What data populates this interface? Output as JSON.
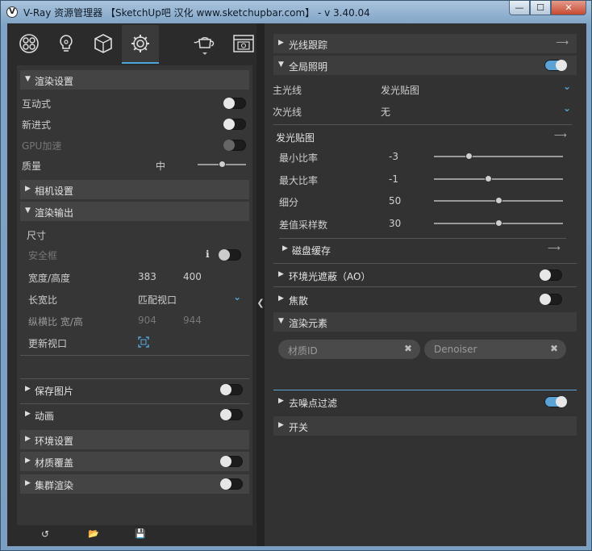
{
  "window": {
    "title": "V-Ray 资源管理器 【SketchUp吧 汉化 www.sketchupbar.com】 - v 3.40.04",
    "min_label": "—",
    "max_label": "☐",
    "close_label": "✕"
  },
  "toolbar": {
    "tabs": [
      "materials-icon",
      "lights-icon",
      "geometry-icon",
      "settings-icon"
    ],
    "active": "settings-icon",
    "right_icons": [
      "teapot-render-icon",
      "frame-buffer-icon"
    ]
  },
  "left": {
    "render_settings": {
      "title": "渲染设置",
      "interactive_label": "互动式",
      "interactive": false,
      "progressive_label": "新进式",
      "progressive": false,
      "gpu_label": "GPU加速",
      "gpu": false,
      "quality_label": "质量",
      "quality_value": "中",
      "quality_level": 0.5
    },
    "camera_title": "相机设置",
    "render_output": {
      "title": "渲染输出",
      "size_label": "尺寸",
      "safe_frame_label": "安全框",
      "safe_frame_info": "ℹ",
      "safe_frame": false,
      "wh_label": "宽度/高度",
      "width": "383",
      "height": "400",
      "aspect_label": "长宽比",
      "aspect_value": "匹配视口",
      "ratio_label": "纵横比 宽/高",
      "ratio_w": "904",
      "ratio_h": "944",
      "update_label": "更新视口"
    },
    "save_image_title": "保存图片",
    "save_image": false,
    "animation_title": "动画",
    "animation": false,
    "environment_title": "环境设置",
    "material_override_title": "材质覆盖",
    "material_override": false,
    "swarm_title": "集群渲染",
    "swarm": false,
    "bottom": {
      "revert_icon": "↺",
      "open_icon": "📂",
      "save_icon": "💾"
    }
  },
  "right": {
    "raytrace_title": "光线跟踪",
    "gi": {
      "title": "全局照明",
      "enabled": true,
      "primary_label": "主光线",
      "primary_value": "发光贴图",
      "secondary_label": "次光线",
      "secondary_value": "无"
    },
    "irradiance": {
      "title": "发光贴图",
      "min_rate_label": "最小比率",
      "min_rate": "-3",
      "min_rate_level": 0.27,
      "max_rate_label": "最大比率",
      "max_rate": "-1",
      "max_rate_level": 0.42,
      "subdivs_label": "细分",
      "subdivs": "50",
      "subdivs_level": 0.5,
      "interp_label": "差值采样数",
      "interp": "30",
      "interp_level": 0.5
    },
    "disk_cache_title": "磁盘缓存",
    "ao_title": "环境光遮蔽（AO）",
    "ao": false,
    "caustics_title": "焦散",
    "caustics": false,
    "render_elements": {
      "title": "渲染元素",
      "chips": [
        "材质ID",
        "Denoiser"
      ]
    },
    "denoiser_title": "去噪点过滤",
    "denoiser": true,
    "switches_title": "开关"
  }
}
